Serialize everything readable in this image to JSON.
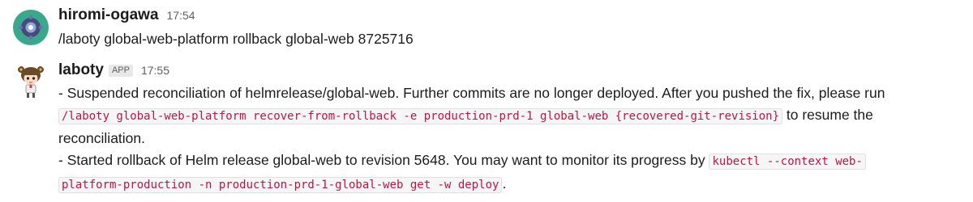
{
  "messages": [
    {
      "username": "hiromi-ogawa",
      "timestamp": "17:54",
      "text": "/laboty global-web-platform rollback global-web 8725716"
    },
    {
      "username": "laboty",
      "badge": "APP",
      "timestamp": "17:55",
      "line1": "- Suspended reconciliation of helmrelease/global-web. Further commits are no longer deployed. After you pushed the fix, please run",
      "line2_code": "/laboty global-web-platform recover-from-rollback -e production-prd-1 global-web {recovered-git-revision}",
      "line2_text": " to resume the",
      "line3": "reconciliation.",
      "line4_text": "- Started rollback of Helm release global-web to revision 5648. You may want to monitor its progress by ",
      "line4_code": "kubectl --context web-",
      "line5_code": "platform-production -n production-prd-1-global-web get -w deploy",
      "line5_text": "."
    }
  ]
}
